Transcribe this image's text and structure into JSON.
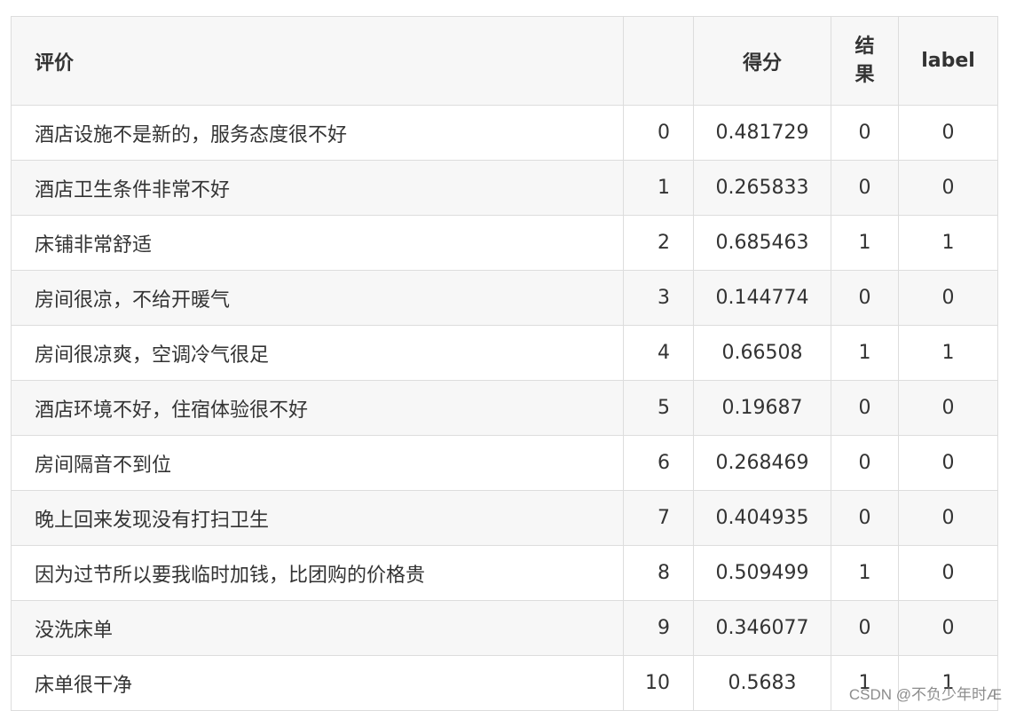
{
  "table": {
    "headers": {
      "review": "评价",
      "index": "",
      "score": "得分",
      "result_line1": "结",
      "result_line2": "果",
      "label": "label"
    },
    "rows": [
      {
        "review": "酒店设施不是新的，服务态度很不好",
        "index": "0",
        "score": "0.481729",
        "result": "0",
        "label": "0"
      },
      {
        "review": "酒店卫生条件非常不好",
        "index": "1",
        "score": "0.265833",
        "result": "0",
        "label": "0"
      },
      {
        "review": "床铺非常舒适",
        "index": "2",
        "score": "0.685463",
        "result": "1",
        "label": "1"
      },
      {
        "review": "房间很凉，不给开暖气",
        "index": "3",
        "score": "0.144774",
        "result": "0",
        "label": "0"
      },
      {
        "review": "房间很凉爽，空调冷气很足",
        "index": "4",
        "score": "0.66508",
        "result": "1",
        "label": "1"
      },
      {
        "review": "酒店环境不好，住宿体验很不好",
        "index": "5",
        "score": "0.19687",
        "result": "0",
        "label": "0"
      },
      {
        "review": "房间隔音不到位",
        "index": "6",
        "score": "0.268469",
        "result": "0",
        "label": "0"
      },
      {
        "review": "晚上回来发现没有打扫卫生",
        "index": "7",
        "score": "0.404935",
        "result": "0",
        "label": "0"
      },
      {
        "review": "因为过节所以要我临时加钱，比团购的价格贵",
        "index": "8",
        "score": "0.509499",
        "result": "1",
        "label": "0"
      },
      {
        "review": "没洗床单",
        "index": "9",
        "score": "0.346077",
        "result": "0",
        "label": "0"
      },
      {
        "review": "床单很干净",
        "index": "10",
        "score": "0.5683",
        "result": "1",
        "label": "1"
      }
    ]
  },
  "watermark": "CSDN @不负少年时Æ"
}
